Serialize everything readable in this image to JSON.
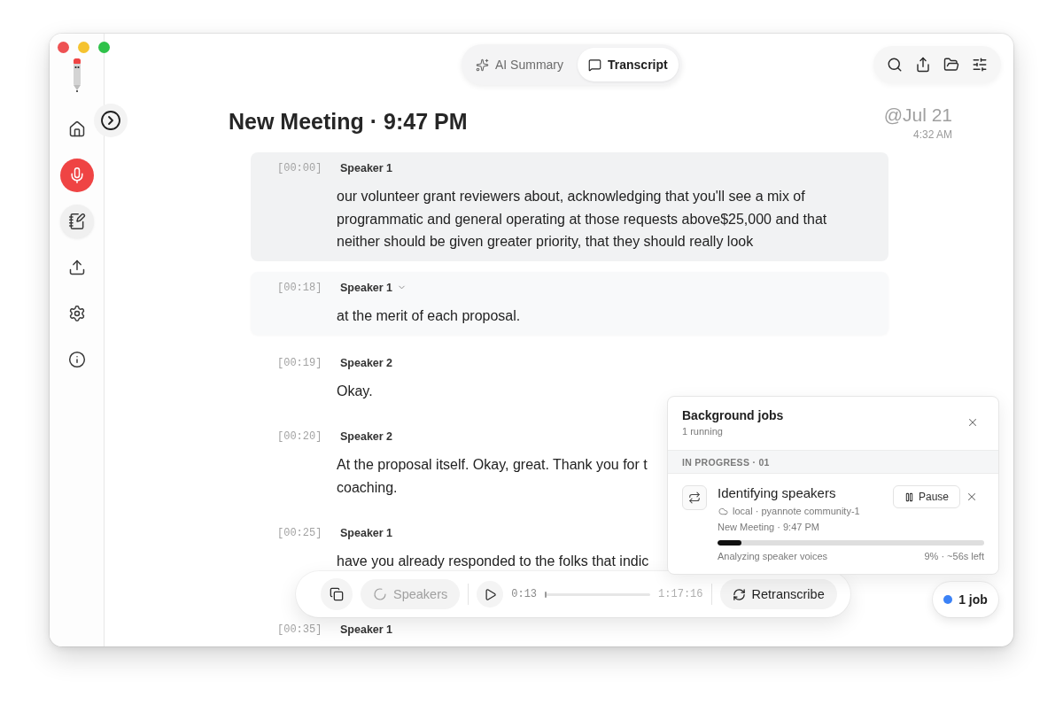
{
  "sidebar": {
    "items": [
      {
        "kind": "home",
        "selected": false
      },
      {
        "kind": "record",
        "selected": false
      },
      {
        "kind": "notes",
        "selected": true
      },
      {
        "kind": "upload",
        "selected": false
      },
      {
        "kind": "settings",
        "selected": false
      },
      {
        "kind": "info",
        "selected": false
      }
    ]
  },
  "tabs": [
    {
      "label": "AI Summary",
      "selected": false
    },
    {
      "label": "Transcript",
      "selected": true
    }
  ],
  "header": {
    "title": "New Meeting · 9:47 PM",
    "date": "@Jul 21",
    "time": "4:32 AM"
  },
  "transcript": {
    "segments": [
      {
        "timestamp": "[00:00]",
        "speaker": "Speaker 1",
        "playing": true,
        "hovered": false,
        "lines": [
          "our volunteer grant reviewers about, acknowledging that you'll see a mix of",
          "programmatic and general operating at those requests above$25,000 and that",
          "neither should be given greater priority, that they should really look"
        ]
      },
      {
        "timestamp": "[00:18]",
        "speaker": "Speaker 1",
        "playing": false,
        "hovered": true,
        "lines": [
          "at the merit of each proposal."
        ]
      },
      {
        "timestamp": "[00:19]",
        "speaker": "Speaker 2",
        "playing": false,
        "hovered": false,
        "lines": [
          "Okay."
        ]
      },
      {
        "timestamp": "[00:20]",
        "speaker": "Speaker 2",
        "playing": false,
        "hovered": false,
        "lines": [
          "At the proposal itself. Okay, great. Thank you for t",
          "coaching."
        ]
      },
      {
        "timestamp": "[00:25]",
        "speaker": "Speaker 1",
        "playing": false,
        "hovered": false,
        "lines": [
          "have you already responded to the folks that indic"
        ]
      },
      {
        "timestamp": "[00:35]",
        "speaker": "Speaker 1",
        "playing": false,
        "hovered": false
      }
    ]
  },
  "player": {
    "speakers": {
      "label": "Speakers",
      "disabled": true
    },
    "current_time": "0:13",
    "level": 0.003,
    "duration": "1:17:16",
    "retranscribe": {
      "label": "Retranscribe"
    }
  },
  "jobs_panel": {
    "title": "Background jobs",
    "subtitle": "1 running",
    "section": "IN PROGRESS · 01",
    "jobs": [
      {
        "title": "Identifying speakers",
        "source": "local · pyannote community-1",
        "meeting": "New Meeting · 9:47 PM",
        "level": 0.09,
        "status": "Analyzing speaker voices",
        "progress": "9% · ~56s left",
        "pause_label": "Pause"
      }
    ]
  },
  "jobs_badge": {
    "label": "1 job"
  }
}
